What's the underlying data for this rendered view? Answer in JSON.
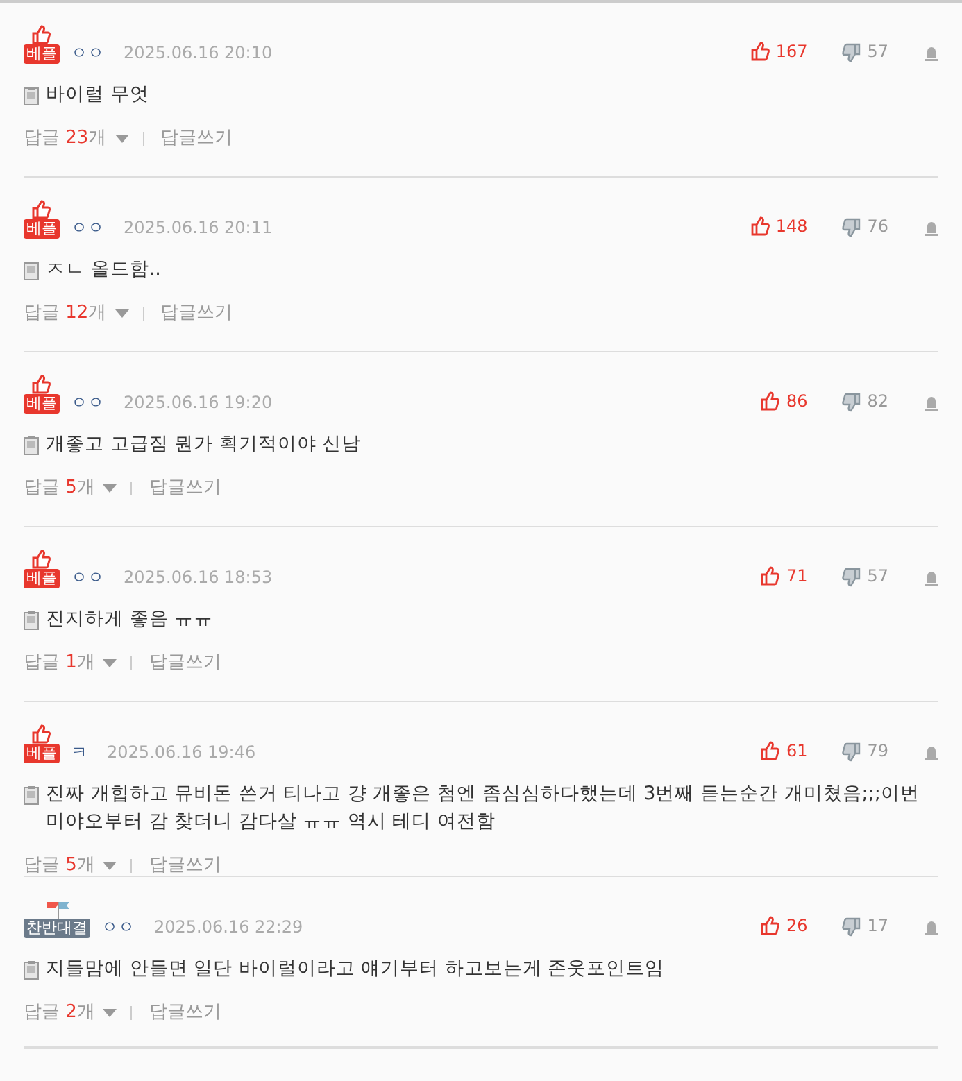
{
  "comments": [
    {
      "badge": {
        "kind": "best",
        "label": "베플"
      },
      "author": "ㅇㅇ",
      "date": "2025.06.16 20:10",
      "likes": "167",
      "dislikes": "57",
      "text": "바이럴 무엇",
      "reply_label": "답글",
      "reply_count": "23",
      "reply_unit": "개",
      "write_reply": "답글쓰기"
    },
    {
      "badge": {
        "kind": "best",
        "label": "베플"
      },
      "author": "ㅇㅇ",
      "date": "2025.06.16 20:11",
      "likes": "148",
      "dislikes": "76",
      "text": "ㅈㄴ 올드함..",
      "reply_label": "답글",
      "reply_count": "12",
      "reply_unit": "개",
      "write_reply": "답글쓰기"
    },
    {
      "badge": {
        "kind": "best",
        "label": "베플"
      },
      "author": "ㅇㅇ",
      "date": "2025.06.16 19:20",
      "likes": "86",
      "dislikes": "82",
      "text": "개좋고 고급짐 뭔가 획기적이야 신남",
      "reply_label": "답글",
      "reply_count": "5",
      "reply_unit": "개",
      "write_reply": "답글쓰기"
    },
    {
      "badge": {
        "kind": "best",
        "label": "베플"
      },
      "author": "ㅇㅇ",
      "date": "2025.06.16 18:53",
      "likes": "71",
      "dislikes": "57",
      "text": "진지하게 좋음 ㅠㅠ",
      "reply_label": "답글",
      "reply_count": "1",
      "reply_unit": "개",
      "write_reply": "답글쓰기"
    },
    {
      "badge": {
        "kind": "best",
        "label": "베플"
      },
      "author": "ㅋ",
      "date": "2025.06.16 19:46",
      "likes": "61",
      "dislikes": "79",
      "text": "진짜 개힙하고 뮤비돈 쓴거 티나고 걍 개좋은 첨엔 좀심심하다했는데 3번째 듣는순간 개미쳤음;;;이번 미야오부터 감 찾더니 감다살 ㅠㅠ 역시 테디 여전함",
      "reply_label": "답글",
      "reply_count": "5",
      "reply_unit": "개",
      "write_reply": "답글쓰기"
    },
    {
      "badge": {
        "kind": "debate",
        "label": "찬반대결"
      },
      "author": "ㅇㅇ",
      "date": "2025.06.16 22:29",
      "likes": "26",
      "dislikes": "17",
      "text": "지들맘에 안들면 일단 바이럴이라고 얘기부터 하고보는게 존웃포인트임",
      "reply_label": "답글",
      "reply_count": "2",
      "reply_unit": "개",
      "write_reply": "답글쓰기"
    }
  ]
}
